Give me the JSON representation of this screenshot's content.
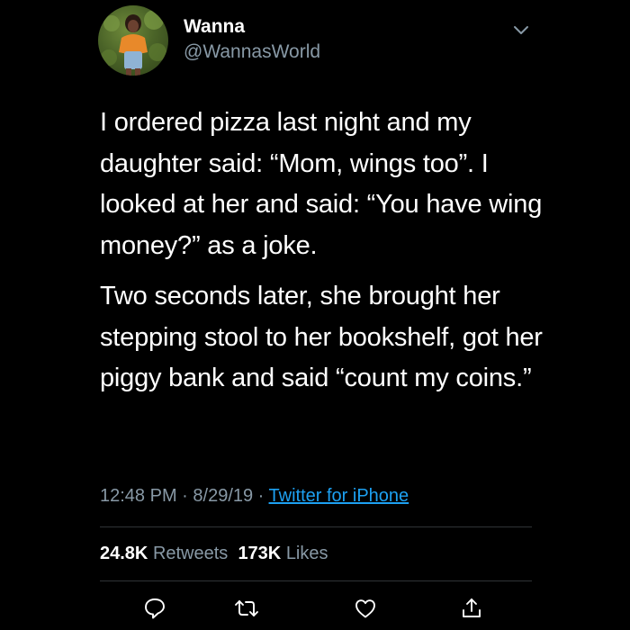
{
  "user": {
    "name": "Wanna",
    "handle": "@WannasWorld",
    "avatar_icon": "profile-photo"
  },
  "tweet": {
    "paragraphs": [
      "I ordered pizza last night and my daughter said: “Mom, wings too”. I looked at her and said: “You have wing money?” as a joke.",
      "Two seconds later, she brought her stepping stool to her bookshelf, got her piggy bank and said “count my coins.”"
    ]
  },
  "meta": {
    "time": "12:48 PM",
    "date": "8/29/19",
    "separator": " · ",
    "source": "Twitter for iPhone"
  },
  "stats": {
    "retweets_count": "24.8K",
    "retweets_label": "Retweets",
    "likes_count": "173K",
    "likes_label": "Likes"
  },
  "actions": [
    "reply-icon",
    "retweet-icon",
    "like-icon",
    "share-icon"
  ],
  "colors": {
    "background": "#000000",
    "text": "#ffffff",
    "muted": "#8899a6",
    "link": "#1da1f2",
    "divider": "#2f3336"
  }
}
